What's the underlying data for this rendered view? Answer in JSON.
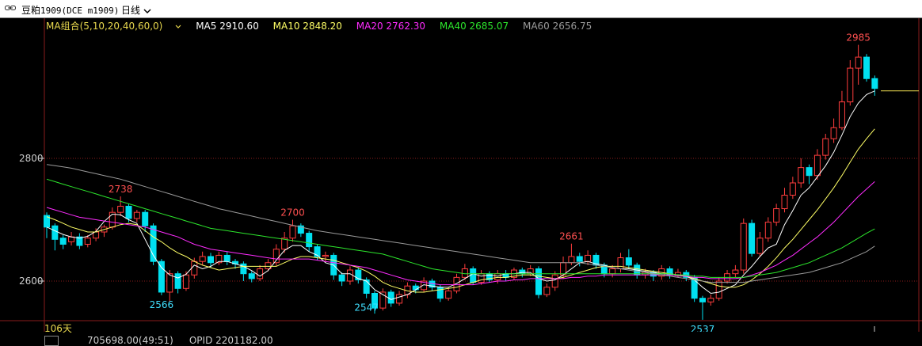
{
  "titlebar": {
    "symbol_cn": "豆粕",
    "symbol_code": "1909(DCE m1909)",
    "period": "日线",
    "period_icon": "chevron-down-icon",
    "symbol_icon": "link-icon"
  },
  "ma_legend": {
    "group": "MA组合(5,10,20,40,60,0)",
    "ma5": "MA5 2910.60",
    "ma10": "MA10 2848.20",
    "ma20": "MA20 2762.30",
    "ma40": "MA40 2685.07",
    "ma60": "MA60 2656.75"
  },
  "colors": {
    "up": "#ff3d3d",
    "down": "#00e0f0",
    "ma5": "#ffffff",
    "ma10": "#ffff66",
    "ma20": "#ff2cff",
    "ma40": "#2ce62c",
    "ma60": "#9a9a9a",
    "grid": "#8a1c1c"
  },
  "yaxis": {
    "labels": [
      "2800",
      "2600"
    ]
  },
  "days_label": "106天",
  "footer": {
    "vol": "705698.00(49:51)",
    "opid": "OPID 2201182.00"
  },
  "chart_data": {
    "type": "candlestick",
    "y_range": [
      2512,
      3006
    ],
    "annotations": [
      {
        "label": "2738",
        "kind": "high",
        "index": 9
      },
      {
        "label": "2566",
        "kind": "low",
        "index": 14
      },
      {
        "label": "2700",
        "kind": "high",
        "index": 30
      },
      {
        "label": "2547",
        "kind": "low",
        "index": 39
      },
      {
        "label": "2661",
        "kind": "high",
        "index": 64
      },
      {
        "label": "2537",
        "kind": "low",
        "index": 80
      },
      {
        "label": "2985",
        "kind": "high",
        "index": 99
      }
    ],
    "candles": [
      [
        2707,
        2688,
        2712,
        2670
      ],
      [
        2690,
        2668,
        2694,
        2650
      ],
      [
        2670,
        2660,
        2675,
        2652
      ],
      [
        2664,
        2672,
        2680,
        2658
      ],
      [
        2672,
        2658,
        2678,
        2652
      ],
      [
        2660,
        2670,
        2675,
        2655
      ],
      [
        2670,
        2680,
        2686,
        2665
      ],
      [
        2680,
        2688,
        2692,
        2672
      ],
      [
        2688,
        2712,
        2720,
        2684
      ],
      [
        2712,
        2722,
        2738,
        2706
      ],
      [
        2722,
        2702,
        2726,
        2696
      ],
      [
        2702,
        2712,
        2716,
        2696
      ],
      [
        2712,
        2690,
        2716,
        2680
      ],
      [
        2690,
        2632,
        2694,
        2626
      ],
      [
        2632,
        2582,
        2636,
        2577
      ],
      [
        2582,
        2612,
        2618,
        2566
      ],
      [
        2612,
        2588,
        2616,
        2580
      ],
      [
        2588,
        2610,
        2616,
        2584
      ],
      [
        2610,
        2632,
        2638,
        2604
      ],
      [
        2632,
        2640,
        2648,
        2626
      ],
      [
        2640,
        2630,
        2646,
        2622
      ],
      [
        2630,
        2642,
        2648,
        2626
      ],
      [
        2642,
        2632,
        2648,
        2626
      ],
      [
        2632,
        2628,
        2636,
        2620
      ],
      [
        2628,
        2612,
        2632,
        2600
      ],
      [
        2612,
        2604,
        2616,
        2598
      ],
      [
        2604,
        2620,
        2626,
        2600
      ],
      [
        2620,
        2630,
        2636,
        2616
      ],
      [
        2630,
        2652,
        2660,
        2624
      ],
      [
        2652,
        2670,
        2680,
        2646
      ],
      [
        2670,
        2690,
        2700,
        2664
      ],
      [
        2690,
        2678,
        2694,
        2672
      ],
      [
        2678,
        2656,
        2682,
        2648
      ],
      [
        2656,
        2640,
        2660,
        2634
      ],
      [
        2640,
        2642,
        2648,
        2632
      ],
      [
        2642,
        2610,
        2646,
        2602
      ],
      [
        2610,
        2600,
        2614,
        2592
      ],
      [
        2600,
        2618,
        2624,
        2594
      ],
      [
        2618,
        2602,
        2622,
        2596
      ],
      [
        2602,
        2580,
        2606,
        2572
      ],
      [
        2580,
        2556,
        2584,
        2547
      ],
      [
        2556,
        2582,
        2588,
        2552
      ],
      [
        2582,
        2564,
        2586,
        2558
      ],
      [
        2564,
        2578,
        2584,
        2560
      ],
      [
        2578,
        2592,
        2598,
        2572
      ],
      [
        2592,
        2586,
        2596,
        2580
      ],
      [
        2586,
        2600,
        2606,
        2582
      ],
      [
        2600,
        2590,
        2604,
        2584
      ],
      [
        2590,
        2572,
        2594,
        2566
      ],
      [
        2572,
        2584,
        2590,
        2568
      ],
      [
        2584,
        2606,
        2612,
        2580
      ],
      [
        2606,
        2620,
        2628,
        2602
      ],
      [
        2620,
        2598,
        2624,
        2594
      ],
      [
        2598,
        2612,
        2618,
        2594
      ],
      [
        2612,
        2602,
        2616,
        2598
      ],
      [
        2602,
        2612,
        2618,
        2596
      ],
      [
        2612,
        2606,
        2618,
        2600
      ],
      [
        2606,
        2618,
        2622,
        2602
      ],
      [
        2618,
        2612,
        2622,
        2606
      ],
      [
        2612,
        2620,
        2626,
        2608
      ],
      [
        2620,
        2578,
        2624,
        2572
      ],
      [
        2578,
        2590,
        2596,
        2574
      ],
      [
        2590,
        2610,
        2616,
        2584
      ],
      [
        2610,
        2630,
        2640,
        2604
      ],
      [
        2630,
        2640,
        2661,
        2626
      ],
      [
        2640,
        2632,
        2646,
        2624
      ],
      [
        2632,
        2642,
        2650,
        2626
      ],
      [
        2642,
        2626,
        2646,
        2620
      ],
      [
        2626,
        2612,
        2630,
        2606
      ],
      [
        2612,
        2620,
        2626,
        2606
      ],
      [
        2620,
        2638,
        2646,
        2614
      ],
      [
        2638,
        2626,
        2652,
        2620
      ],
      [
        2626,
        2610,
        2630,
        2604
      ],
      [
        2610,
        2614,
        2620,
        2604
      ],
      [
        2614,
        2608,
        2618,
        2600
      ],
      [
        2608,
        2620,
        2626,
        2602
      ],
      [
        2620,
        2610,
        2624,
        2604
      ],
      [
        2610,
        2614,
        2620,
        2606
      ],
      [
        2614,
        2606,
        2618,
        2600
      ],
      [
        2606,
        2572,
        2610,
        2566
      ],
      [
        2572,
        2566,
        2576,
        2537
      ],
      [
        2566,
        2572,
        2578,
        2560
      ],
      [
        2572,
        2600,
        2606,
        2568
      ],
      [
        2600,
        2612,
        2618,
        2596
      ],
      [
        2612,
        2618,
        2626,
        2606
      ],
      [
        2618,
        2694,
        2702,
        2612
      ],
      [
        2694,
        2645,
        2700,
        2640
      ],
      [
        2645,
        2670,
        2680,
        2640
      ],
      [
        2670,
        2696,
        2704,
        2664
      ],
      [
        2696,
        2718,
        2726,
        2690
      ],
      [
        2718,
        2740,
        2752,
        2712
      ],
      [
        2740,
        2760,
        2770,
        2734
      ],
      [
        2760,
        2785,
        2800,
        2752
      ],
      [
        2785,
        2772,
        2790,
        2758
      ],
      [
        2772,
        2805,
        2815,
        2765
      ],
      [
        2805,
        2832,
        2840,
        2798
      ],
      [
        2832,
        2850,
        2865,
        2825
      ],
      [
        2850,
        2892,
        2910,
        2846
      ],
      [
        2892,
        2947,
        2960,
        2886
      ],
      [
        2947,
        2965,
        2985,
        2920
      ],
      [
        2965,
        2930,
        2970,
        2925
      ],
      [
        2930,
        2914,
        2935,
        2902
      ]
    ],
    "ma_series": [
      {
        "name": "MA5",
        "color_key": "ma5",
        "values": [
          2688,
          2682,
          2676,
          2672,
          2670,
          2673,
          2681,
          2697,
          2709,
          2708,
          2700,
          2694,
          2668,
          2642,
          2622,
          2610,
          2605,
          2611,
          2626,
          2620,
          2624,
          2632,
          2632,
          2628,
          2624,
          2617,
          2608,
          2617,
          2634,
          2650,
          2658,
          2658,
          2648,
          2642,
          2630,
          2626,
          2612,
          2612,
          2604,
          2600,
          2586,
          2578,
          2570,
          2574,
          2578,
          2586,
          2594,
          2592,
          2590,
          2590,
          2596,
          2604,
          2612,
          2608,
          2610,
          2608,
          2612,
          2612,
          2614,
          2614,
          2604,
          2600,
          2602,
          2610,
          2620,
          2630,
          2632,
          2628,
          2626,
          2622,
          2620,
          2620,
          2618,
          2616,
          2614,
          2612,
          2612,
          2610,
          2608,
          2602,
          2590,
          2580,
          2582,
          2588,
          2594,
          2610,
          2624,
          2640,
          2654,
          2660,
          2692,
          2715,
          2740,
          2752,
          2770,
          2788,
          2810,
          2838,
          2868,
          2890,
          2904,
          2910
        ]
      },
      {
        "name": "MA10",
        "color_key": "ma10",
        "values": [
          2705,
          2700,
          2694,
          2688,
          2684,
          2680,
          2680,
          2684,
          2688,
          2692,
          2694,
          2692,
          2682,
          2672,
          2664,
          2654,
          2646,
          2640,
          2632,
          2626,
          2622,
          2618,
          2620,
          2622,
          2624,
          2624,
          2624,
          2624,
          2624,
          2630,
          2636,
          2640,
          2640,
          2638,
          2636,
          2634,
          2630,
          2626,
          2622,
          2616,
          2608,
          2598,
          2592,
          2588,
          2584,
          2582,
          2582,
          2584,
          2586,
          2588,
          2590,
          2594,
          2598,
          2602,
          2604,
          2606,
          2606,
          2608,
          2610,
          2610,
          2608,
          2606,
          2604,
          2606,
          2610,
          2614,
          2618,
          2622,
          2624,
          2624,
          2624,
          2622,
          2620,
          2618,
          2616,
          2614,
          2612,
          2610,
          2608,
          2604,
          2600,
          2596,
          2592,
          2590,
          2590,
          2594,
          2602,
          2612,
          2624,
          2638,
          2654,
          2668,
          2684,
          2700,
          2716,
          2734,
          2752,
          2772,
          2794,
          2815,
          2832,
          2848
        ]
      },
      {
        "name": "MA20",
        "color_key": "ma20",
        "values": [
          2720,
          2716,
          2712,
          2708,
          2704,
          2702,
          2700,
          2698,
          2696,
          2694,
          2692,
          2690,
          2688,
          2684,
          2680,
          2676,
          2672,
          2666,
          2660,
          2656,
          2652,
          2650,
          2648,
          2646,
          2644,
          2642,
          2640,
          2638,
          2636,
          2636,
          2636,
          2636,
          2636,
          2634,
          2632,
          2630,
          2628,
          2626,
          2624,
          2622,
          2618,
          2614,
          2610,
          2606,
          2602,
          2600,
          2598,
          2596,
          2594,
          2594,
          2594,
          2594,
          2594,
          2596,
          2598,
          2600,
          2600,
          2602,
          2602,
          2604,
          2604,
          2604,
          2604,
          2604,
          2606,
          2606,
          2608,
          2608,
          2610,
          2610,
          2610,
          2610,
          2610,
          2610,
          2610,
          2610,
          2610,
          2608,
          2608,
          2606,
          2606,
          2604,
          2604,
          2604,
          2604,
          2606,
          2610,
          2614,
          2620,
          2626,
          2634,
          2642,
          2652,
          2662,
          2672,
          2684,
          2696,
          2710,
          2724,
          2738,
          2750,
          2762
        ]
      },
      {
        "name": "MA40",
        "color_key": "ma40",
        "values": [
          2766,
          2762,
          2758,
          2754,
          2750,
          2746,
          2742,
          2738,
          2734,
          2730,
          2726,
          2722,
          2718,
          2714,
          2710,
          2706,
          2702,
          2698,
          2694,
          2690,
          2686,
          2684,
          2682,
          2680,
          2678,
          2676,
          2674,
          2672,
          2670,
          2668,
          2666,
          2664,
          2662,
          2660,
          2658,
          2656,
          2654,
          2652,
          2650,
          2648,
          2646,
          2644,
          2640,
          2636,
          2632,
          2628,
          2624,
          2620,
          2618,
          2616,
          2614,
          2612,
          2612,
          2612,
          2612,
          2612,
          2612,
          2612,
          2612,
          2612,
          2612,
          2612,
          2612,
          2612,
          2612,
          2612,
          2612,
          2612,
          2612,
          2612,
          2612,
          2612,
          2612,
          2612,
          2612,
          2612,
          2612,
          2610,
          2610,
          2608,
          2608,
          2606,
          2606,
          2606,
          2606,
          2606,
          2608,
          2610,
          2612,
          2614,
          2618,
          2622,
          2626,
          2630,
          2636,
          2642,
          2648,
          2654,
          2662,
          2670,
          2678,
          2685
        ]
      },
      {
        "name": "MA60",
        "color_key": "ma60",
        "values": [
          2790,
          2788,
          2786,
          2784,
          2781,
          2778,
          2775,
          2772,
          2769,
          2766,
          2762,
          2758,
          2754,
          2750,
          2746,
          2742,
          2738,
          2734,
          2730,
          2726,
          2722,
          2718,
          2715,
          2712,
          2709,
          2706,
          2703,
          2700,
          2697,
          2694,
          2691,
          2688,
          2685,
          2682,
          2680,
          2678,
          2676,
          2674,
          2672,
          2670,
          2668,
          2666,
          2664,
          2662,
          2660,
          2658,
          2656,
          2654,
          2652,
          2650,
          2648,
          2646,
          2644,
          2642,
          2640,
          2638,
          2636,
          2634,
          2632,
          2630,
          2630,
          2630,
          2630,
          2630,
          2630,
          2630,
          2628,
          2626,
          2624,
          2622,
          2620,
          2618,
          2616,
          2614,
          2612,
          2610,
          2608,
          2606,
          2604,
          2602,
          2600,
          2598,
          2598,
          2598,
          2598,
          2598,
          2600,
          2602,
          2604,
          2606,
          2608,
          2610,
          2612,
          2614,
          2618,
          2622,
          2626,
          2630,
          2636,
          2642,
          2648,
          2657
        ]
      }
    ],
    "last_price_line": 2910
  }
}
